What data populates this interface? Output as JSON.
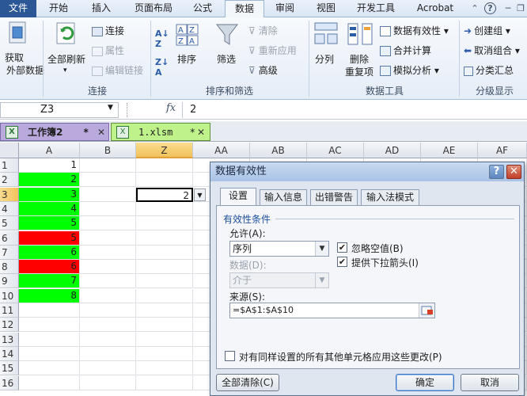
{
  "menu_tabs": [
    "文件",
    "开始",
    "插入",
    "页面布局",
    "公式",
    "数据",
    "审阅",
    "视图",
    "开发工具",
    "Acrobat"
  ],
  "ribbon": {
    "get_data_l1": "获取",
    "get_data_l2": "外部数据",
    "refresh_all": "全部刷新",
    "connections": "连接",
    "properties": "属性",
    "edit_links": "编辑链接",
    "group_connections": "连接",
    "sort": "排序",
    "filter": "筛选",
    "clear": "清除",
    "reapply": "重新应用",
    "advanced": "高级",
    "group_sort_filter": "排序和筛选",
    "text_to_columns": "分列",
    "remove_dup_l1": "删除",
    "remove_dup_l2": "重复项",
    "data_validation": "数据有效性",
    "consolidate": "合并计算",
    "what_if": "模拟分析",
    "group_data_tools": "数据工具",
    "group": "创建组",
    "ungroup": "取消组合",
    "subtotal": "分类汇总",
    "group_outline": "分级显示"
  },
  "formula_bar": {
    "name_box": "Z3",
    "fx": "fx",
    "value": "2"
  },
  "workbook_tabs": [
    {
      "name": "工作簿2",
      "mark": "*"
    },
    {
      "name": "1.xlsm",
      "mark": "*"
    }
  ],
  "columns": [
    "A",
    "B",
    "Z",
    "AA",
    "AB",
    "AC",
    "AD",
    "AE",
    "AF"
  ],
  "rows": [
    "1",
    "2",
    "3",
    "4",
    "5",
    "6",
    "7",
    "8",
    "9",
    "10",
    "11",
    "12",
    "13",
    "14",
    "15",
    "16"
  ],
  "column_a_values": [
    "1",
    "2",
    "3",
    "4",
    "5",
    "5",
    "6",
    "6",
    "7",
    "8"
  ],
  "column_a_fill": [
    "white",
    "green",
    "green",
    "green",
    "green",
    "red",
    "green",
    "red",
    "green",
    "green"
  ],
  "colors": {
    "green": "#00ff00",
    "red": "#ff0000",
    "selection": "#f2c25c"
  },
  "active_cell": {
    "ref": "Z3",
    "value": "2"
  },
  "dialog": {
    "title": "数据有效性",
    "tabs": [
      "设置",
      "输入信息",
      "出错警告",
      "输入法模式"
    ],
    "section": "有效性条件",
    "allow_label": "允许(A):",
    "allow_value": "序列",
    "data_label": "数据(D):",
    "data_value": "介于",
    "ignore_blank": "忽略空值(B)",
    "in_cell_dropdown": "提供下拉箭头(I)",
    "source_label": "来源(S):",
    "source_value": "=$A$1:$A$10",
    "apply_all": "对有同样设置的所有其他单元格应用这些更改(P)",
    "clear_all": "全部清除(C)",
    "ok": "确定",
    "cancel": "取消"
  }
}
